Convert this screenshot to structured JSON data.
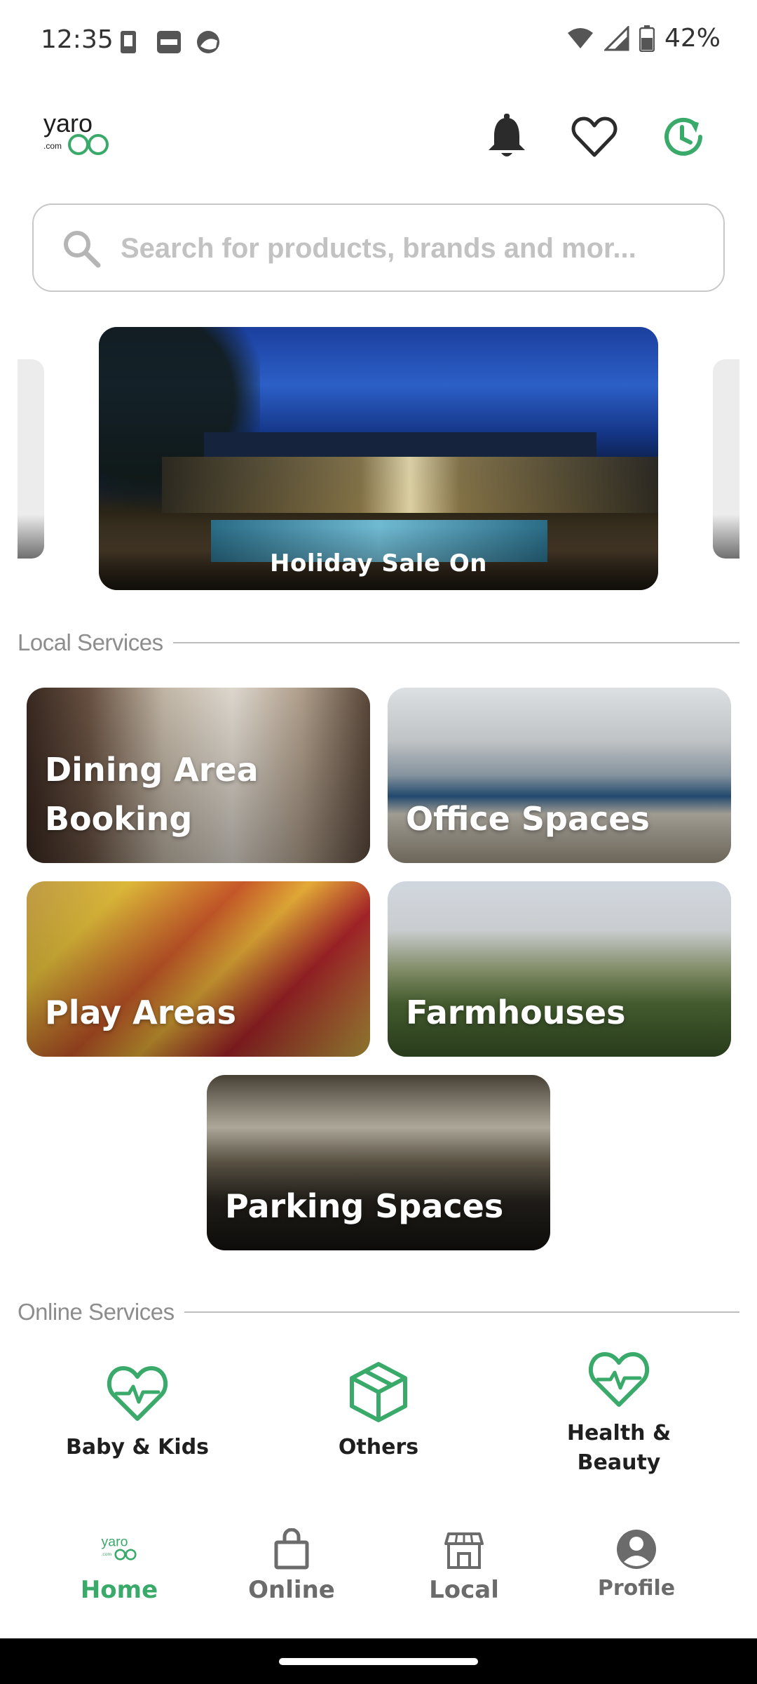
{
  "status_bar": {
    "time": "12:35",
    "battery": "42%",
    "icons": [
      "sim-card-icon",
      "paytm-icon",
      "photos-icon",
      "wifi-icon",
      "signal-icon",
      "battery-icon"
    ]
  },
  "header": {
    "logo_text": "yaro",
    "logo_sub": ".com",
    "icons": [
      "bell-icon",
      "heart-icon",
      "history-icon"
    ]
  },
  "search": {
    "placeholder": "Search for products, brands and mor..."
  },
  "banner": {
    "caption": "Holiday Sale On"
  },
  "local_services": {
    "title": "Local Services",
    "items": [
      {
        "label": "Dining Area Booking"
      },
      {
        "label": "Office Spaces"
      },
      {
        "label": "Play Areas"
      },
      {
        "label": "Farmhouses"
      },
      {
        "label": "Parking Spaces"
      }
    ]
  },
  "online_services": {
    "title": "Online Services",
    "items": [
      {
        "label": "Baby & Kids",
        "icon": "heart-pulse-icon"
      },
      {
        "label": "Others",
        "icon": "package-icon"
      },
      {
        "label": "Health & Beauty",
        "icon": "heart-pulse-icon"
      }
    ]
  },
  "bottom_nav": {
    "items": [
      {
        "label": "Home",
        "icon": "yaro-logo-icon",
        "active": true
      },
      {
        "label": "Online",
        "icon": "shopping-bag-icon",
        "active": false
      },
      {
        "label": "Local",
        "icon": "store-icon",
        "active": false
      },
      {
        "label": "Profile",
        "icon": "profile-icon",
        "active": false
      }
    ]
  },
  "colors": {
    "accent": "#3aaa6a",
    "inactive": "#6b6b6b",
    "section_title": "#8d8d8d"
  }
}
